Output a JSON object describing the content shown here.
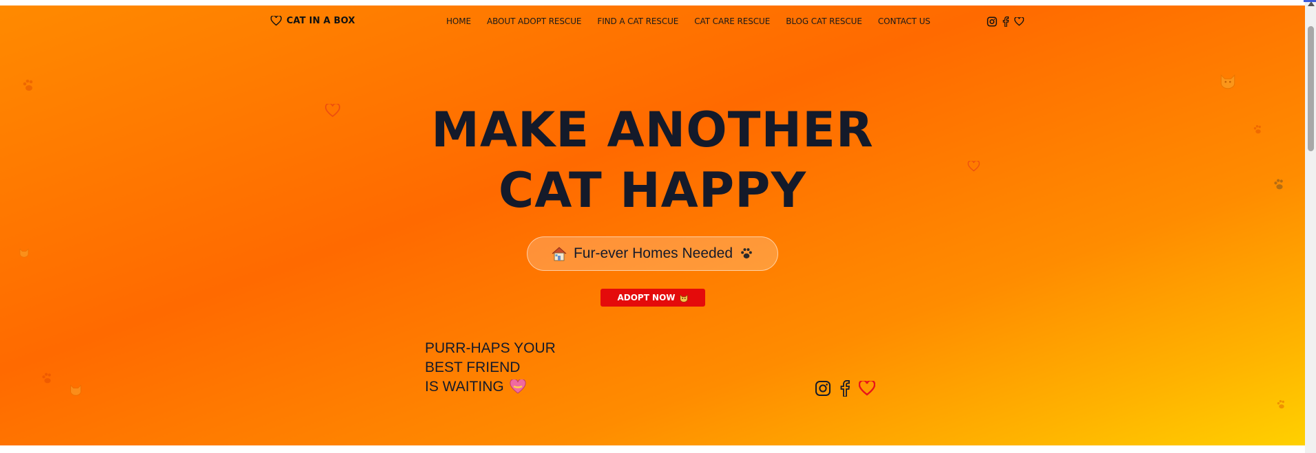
{
  "brand": {
    "name": "CAT IN A BOX",
    "icon": "heart-outline-icon"
  },
  "nav": {
    "items": [
      {
        "label": "HOME"
      },
      {
        "label": "ABOUT ADOPT RESCUE"
      },
      {
        "label": "FIND A CAT RESCUE"
      },
      {
        "label": "CAT CARE RESCUE"
      },
      {
        "label": "BLOG CAT RESCUE"
      },
      {
        "label": "CONTACT US"
      }
    ],
    "social_icons": [
      "instagram-icon",
      "facebook-icon",
      "heart-icon"
    ]
  },
  "hero": {
    "title_line1": "MAKE ANOTHER",
    "title_line2": "CAT HAPPY",
    "pill_text": "Fur-ever Homes Needed",
    "pill_icons": [
      "house-icon",
      "paw-icon"
    ],
    "cta_label": "ADOPT NOW",
    "cta_icon": "cat-face-icon",
    "tagline_line1": "PURR-HAPS YOUR",
    "tagline_line2": "BEST FRIEND",
    "tagline_line3": "IS WAITING",
    "tagline_icon": "heart-ribbon-icon",
    "social_icons": [
      "instagram-icon",
      "facebook-icon",
      "heart-icon"
    ]
  },
  "colors": {
    "gradient_start": "#ff8a00",
    "gradient_mid": "#ff6a00",
    "gradient_end": "#ffd000",
    "text_dark": "#141a2a",
    "cta_red": "#e40b0b",
    "heart_red": "#e8141a"
  }
}
